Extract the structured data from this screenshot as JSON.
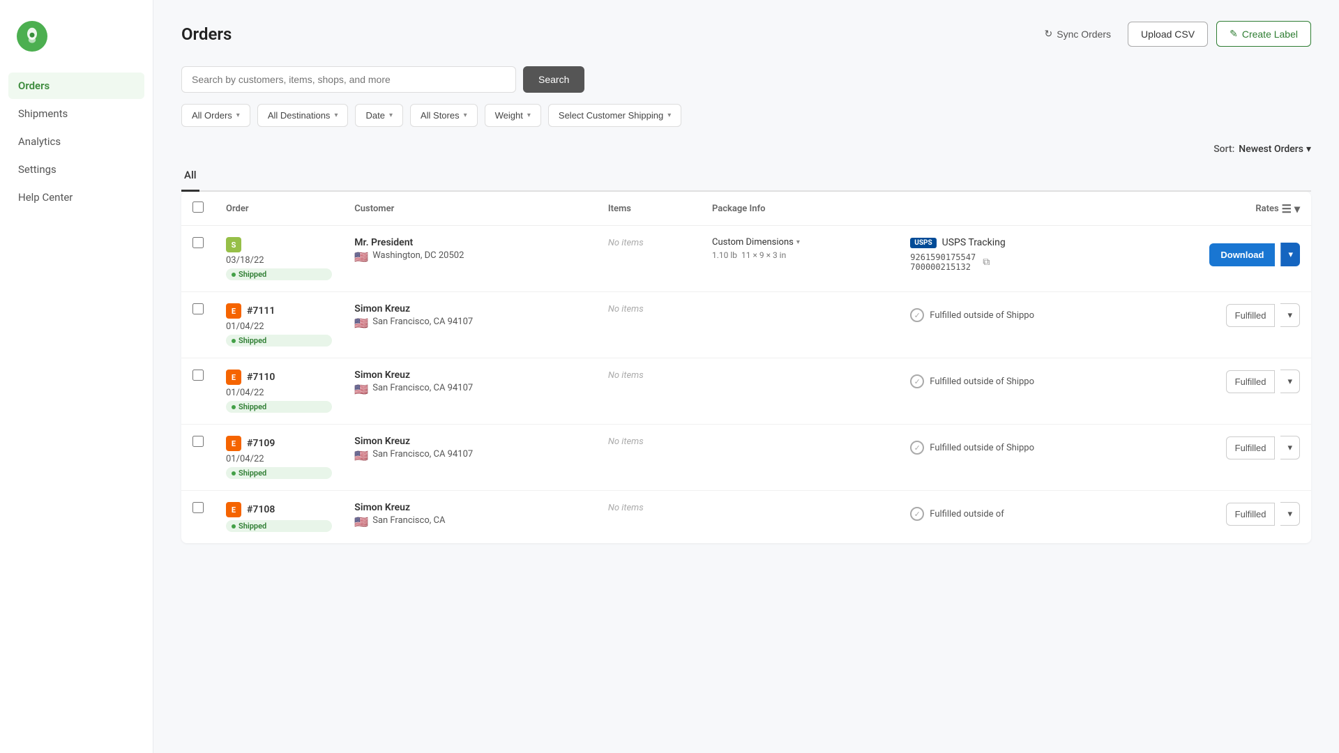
{
  "sidebar": {
    "logo_alt": "Shippo Logo",
    "nav_items": [
      {
        "id": "orders",
        "label": "Orders",
        "active": true
      },
      {
        "id": "shipments",
        "label": "Shipments",
        "active": false
      },
      {
        "id": "analytics",
        "label": "Analytics",
        "active": false
      },
      {
        "id": "settings",
        "label": "Settings",
        "active": false
      },
      {
        "id": "help",
        "label": "Help Center",
        "active": false
      }
    ]
  },
  "header": {
    "title": "Orders",
    "sync_label": "Sync Orders",
    "upload_csv_label": "Upload CSV",
    "create_label_label": "Create Label"
  },
  "search": {
    "placeholder": "Search by customers, items, shops, and more",
    "button_label": "Search"
  },
  "filters": {
    "all_orders_label": "All Orders",
    "all_destinations_label": "All Destinations",
    "date_label": "Date",
    "all_stores_label": "All Stores",
    "weight_label": "Weight",
    "select_customer_shipping_label": "Select Customer Shipping"
  },
  "sort": {
    "label": "Sort:",
    "value": "Newest Orders"
  },
  "tab": {
    "label": "All"
  },
  "table": {
    "columns": {
      "order": "Order",
      "customer": "Customer",
      "items": "Items",
      "package_info": "Package Info",
      "rates": "Rates"
    },
    "rows": [
      {
        "id": "row-1",
        "order_number": "",
        "order_date": "03/18/22",
        "status": "Shipped",
        "store_type": "shopify",
        "store_label": "S",
        "customer_name": "Mr. President",
        "customer_city": "Washington, DC 20502",
        "flag": "🇺🇸",
        "items": "No items",
        "package_type": "Custom Dimensions",
        "weight": "1.10 lb",
        "dimensions": "11 × 9 × 3 in",
        "rate_type": "usps",
        "rate_label": "USPS Tracking",
        "tracking_number": "9261590175547700000215132",
        "action_type": "download",
        "action_label": "Download"
      },
      {
        "id": "row-2",
        "order_number": "#7111",
        "order_date": "01/04/22",
        "status": "Shipped",
        "store_type": "etsy",
        "store_label": "E",
        "customer_name": "Simon Kreuz",
        "customer_city": "San Francisco, CA 94107",
        "flag": "🇺🇸",
        "items": "No items",
        "package_type": "",
        "weight": "",
        "dimensions": "",
        "rate_type": "fulfilled",
        "rate_label": "Fulfilled outside of Shippo",
        "tracking_number": "",
        "action_type": "fulfilled",
        "action_label": "Fulfilled"
      },
      {
        "id": "row-3",
        "order_number": "#7110",
        "order_date": "01/04/22",
        "status": "Shipped",
        "store_type": "etsy",
        "store_label": "E",
        "customer_name": "Simon Kreuz",
        "customer_city": "San Francisco, CA 94107",
        "flag": "🇺🇸",
        "items": "No items",
        "package_type": "",
        "weight": "",
        "dimensions": "",
        "rate_type": "fulfilled",
        "rate_label": "Fulfilled outside of Shippo",
        "tracking_number": "",
        "action_type": "fulfilled",
        "action_label": "Fulfilled"
      },
      {
        "id": "row-4",
        "order_number": "#7109",
        "order_date": "01/04/22",
        "status": "Shipped",
        "store_type": "etsy",
        "store_label": "E",
        "customer_name": "Simon Kreuz",
        "customer_city": "San Francisco, CA 94107",
        "flag": "🇺🇸",
        "items": "No items",
        "package_type": "",
        "weight": "",
        "dimensions": "",
        "rate_type": "fulfilled",
        "rate_label": "Fulfilled outside of Shippo",
        "tracking_number": "",
        "action_type": "fulfilled",
        "action_label": "Fulfilled"
      },
      {
        "id": "row-5",
        "order_number": "#7108",
        "order_date": "",
        "status": "Shipped",
        "store_type": "etsy",
        "store_label": "E",
        "customer_name": "Simon Kreuz",
        "customer_city": "San Francisco, CA",
        "flag": "🇺🇸",
        "items": "No items",
        "package_type": "",
        "weight": "",
        "dimensions": "",
        "rate_type": "fulfilled",
        "rate_label": "Fulfilled outside of",
        "tracking_number": "",
        "action_type": "fulfilled",
        "action_label": "Fulfilled"
      }
    ]
  }
}
